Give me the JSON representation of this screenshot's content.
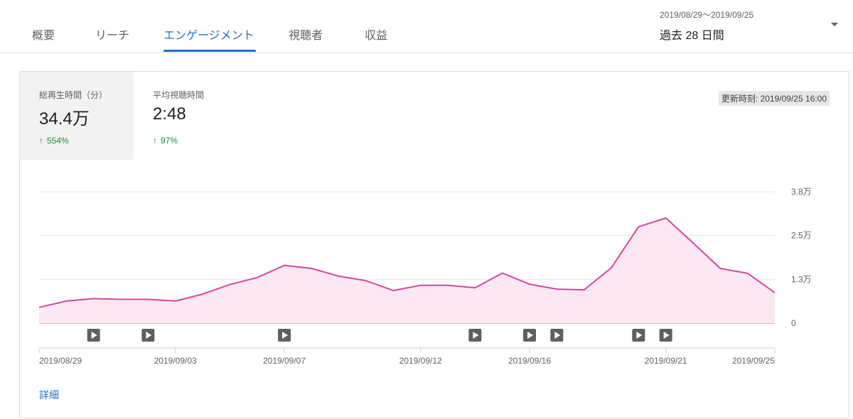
{
  "tabs": [
    {
      "label": "概要",
      "active": false
    },
    {
      "label": "リーチ",
      "active": false
    },
    {
      "label": "エンゲージメント",
      "active": true
    },
    {
      "label": "視聴者",
      "active": false
    },
    {
      "label": "収益",
      "active": false
    }
  ],
  "date_selector": {
    "range": "2019/08/29〜2019/09/25",
    "period": "過去 28 日間"
  },
  "metrics": [
    {
      "label": "総再生時間（分）",
      "value": "34.4万",
      "delta": "554%",
      "selected": true
    },
    {
      "label": "平均視聴時間",
      "value": "2:48",
      "delta": "97%",
      "selected": false
    }
  ],
  "updated": "更新時刻: 2019/09/25 16:00",
  "details_link": "詳細",
  "colors": {
    "accent": "#1f6fd0",
    "line": "#d9469e",
    "fill": "#fbe8f2",
    "positive": "#1e8e3e"
  },
  "chart_data": {
    "type": "area",
    "y_tick_labels": [
      "0",
      "1.3万",
      "2.5万",
      "3.8万"
    ],
    "y_tick_values": [
      0,
      12500,
      25000,
      37500
    ],
    "ylim": [
      0,
      37500
    ],
    "x_dates": [
      "2019/08/29",
      "2019/08/30",
      "2019/08/31",
      "2019/09/01",
      "2019/09/02",
      "2019/09/03",
      "2019/09/04",
      "2019/09/05",
      "2019/09/06",
      "2019/09/07",
      "2019/09/08",
      "2019/09/09",
      "2019/09/10",
      "2019/09/11",
      "2019/09/12",
      "2019/09/13",
      "2019/09/14",
      "2019/09/15",
      "2019/09/16",
      "2019/09/17",
      "2019/09/18",
      "2019/09/19",
      "2019/09/20",
      "2019/09/21",
      "2019/09/22",
      "2019/09/23",
      "2019/09/24",
      "2019/09/25"
    ],
    "x_tick_labels": [
      "2019/08/29",
      "2019/09/03",
      "2019/09/07",
      "2019/09/12",
      "2019/09/16",
      "2019/09/21",
      "2019/09/25"
    ],
    "series": [
      {
        "values": [
          4500,
          6300,
          7000,
          6800,
          6800,
          6300,
          8300,
          11000,
          13000,
          16500,
          15600,
          13400,
          12100,
          9300,
          10800,
          10800,
          10100,
          14300,
          11100,
          9700,
          9500,
          15800,
          27500,
          30000,
          22900,
          15600,
          14200,
          8700
        ]
      }
    ],
    "video_markers": [
      "2019/08/31",
      "2019/09/02",
      "2019/09/07",
      "2019/09/14",
      "2019/09/16",
      "2019/09/17",
      "2019/09/20",
      "2019/09/21"
    ],
    "grid": true
  }
}
